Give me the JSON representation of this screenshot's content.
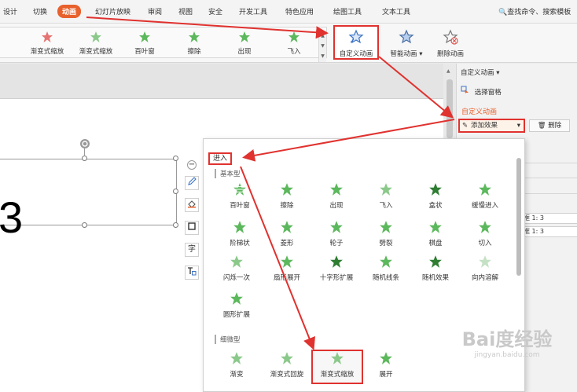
{
  "colors": {
    "accent": "#e8612c",
    "highlight": "#e0322f",
    "star": "#5cb85c"
  },
  "menu": {
    "tabs": [
      "设计",
      "切换",
      "动画",
      "幻灯片放映",
      "审阅",
      "视图",
      "安全",
      "开发工具",
      "特色应用",
      "绘图工具",
      "文本工具"
    ],
    "search": "查找命令、搜索模板"
  },
  "ribbon": {
    "gallery": [
      "渐变式缩放",
      "渐变式缩放",
      "百叶窗",
      "擦除",
      "出现",
      "飞入"
    ],
    "custom_animation": "自定义动画",
    "smart_animation": "智能动画",
    "delete_animation": "删除动画"
  },
  "slide": {
    "number": "3"
  },
  "side_tools": [
    "字"
  ],
  "pane": {
    "title": "自定义动画",
    "select_pane": "选择窗格",
    "heading": "自定义动画",
    "add_effect": "添加效果",
    "delete": "删除",
    "line1": "框 1: 3",
    "line2": "框 1: 3"
  },
  "dropdown": {
    "enter": "进入",
    "basic_title": "基本型",
    "basic": [
      "百叶窗",
      "擦除",
      "出现",
      "飞入",
      "盒状",
      "缓慢进入",
      "阶梯状",
      "菱形",
      "轮子",
      "劈裂",
      "棋盘",
      "切入",
      "闪烁一次",
      "扇形展开",
      "十字形扩展",
      "随机线条",
      "随机效果",
      "向内溶解",
      "圆形扩展"
    ],
    "subtle_title": "细微型",
    "subtle": [
      "渐变",
      "渐变式回旋",
      "渐变式缩放",
      "展开"
    ]
  },
  "watermark": {
    "brand": "Bai度经验",
    "url": "jingyan.baidu.com"
  }
}
